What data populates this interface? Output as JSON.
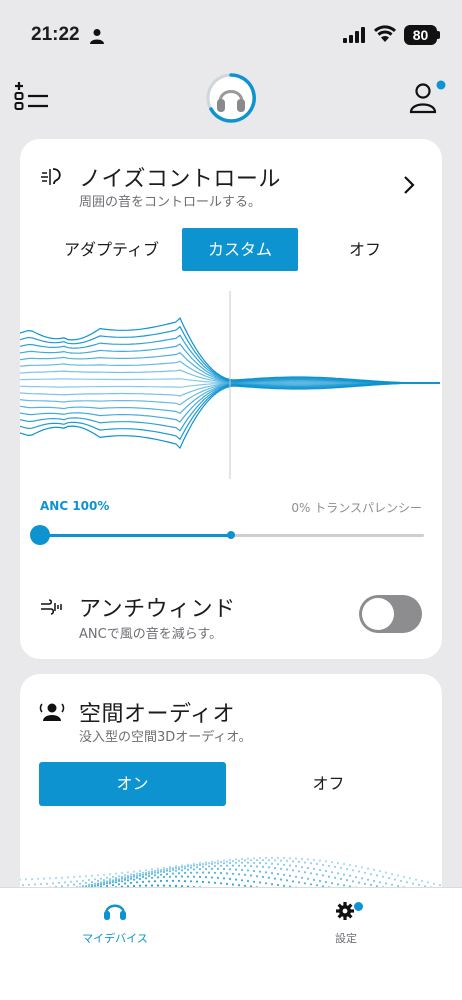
{
  "status": {
    "time": "21:22",
    "battery": "80"
  },
  "noise_control": {
    "title": "ノイズコントロール",
    "subtitle": "周囲の音をコントロールする。",
    "modes": [
      "アダプティブ",
      "カスタム",
      "オフ"
    ],
    "selected_mode": "カスタム",
    "slider_left_label": "ANC 100%",
    "slider_right_label": "0% トランスパレンシー",
    "slider_value": 0
  },
  "anti_wind": {
    "title": "アンチウィンド",
    "subtitle": "ANCで風の音を減らす。",
    "enabled": false
  },
  "spatial_audio": {
    "title": "空間オーディオ",
    "subtitle": "没入型の空間3Dオーディオ。",
    "on_label": "オン",
    "off_label": "オフ",
    "selected": "オン"
  },
  "tabbar": {
    "tabs": [
      {
        "label": "マイデバイス",
        "icon": "headphones-icon",
        "active": true
      },
      {
        "label": "設定",
        "icon": "gear-icon",
        "active": false
      }
    ]
  },
  "colors": {
    "accent": "#0d93d0",
    "background": "#e9e9eb",
    "card": "#ffffff",
    "toggle_off": "#8d8d90"
  }
}
